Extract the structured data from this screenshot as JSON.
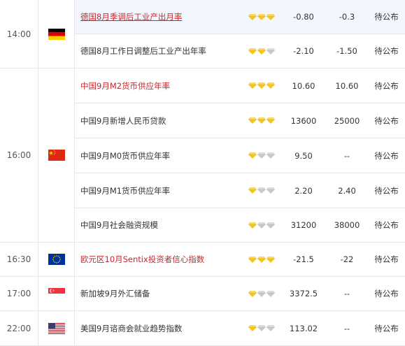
{
  "colors": {
    "gold": "#f5c518",
    "gray": "#c9c9c9",
    "red_text": "#c4292f",
    "highlight_row": "#f3f7fd"
  },
  "star_icon": "gem-icon",
  "groups": [
    {
      "time": "14:00",
      "flag": "germany-flag-icon",
      "rows": [
        {
          "event": "德国8月季调后工业产出月率",
          "importance": 3,
          "previous": "-0.80",
          "forecast": "-0.3",
          "actual": "待公布",
          "red": true,
          "highlight": true
        },
        {
          "event": "德国8月工作日调整后工业产出年率",
          "importance": 2,
          "previous": "-2.10",
          "forecast": "-1.50",
          "actual": "待公布",
          "red": false,
          "highlight": false
        }
      ]
    },
    {
      "time": "16:00",
      "flag": "china-flag-icon",
      "rows": [
        {
          "event": "中国9月M2货币供应年率",
          "importance": 3,
          "previous": "10.60",
          "forecast": "10.60",
          "actual": "待公布",
          "red": true,
          "highlight": false
        },
        {
          "event": "中国9月新增人民币贷款",
          "importance": 3,
          "previous": "13600",
          "forecast": "25000",
          "actual": "待公布",
          "red": false,
          "highlight": false
        },
        {
          "event": "中国9月M0货币供应年率",
          "importance": 1,
          "previous": "9.50",
          "forecast": "--",
          "actual": "待公布",
          "red": false,
          "highlight": false
        },
        {
          "event": "中国9月M1货币供应年率",
          "importance": 1,
          "previous": "2.20",
          "forecast": "2.40",
          "actual": "待公布",
          "red": false,
          "highlight": false
        },
        {
          "event": "中国9月社会融资规模",
          "importance": 1,
          "previous": "31200",
          "forecast": "38000",
          "actual": "待公布",
          "red": false,
          "highlight": false
        }
      ]
    },
    {
      "time": "16:30",
      "flag": "eu-flag-icon",
      "rows": [
        {
          "event": "欧元区10月Sentix投资者信心指数",
          "importance": 3,
          "previous": "-21.5",
          "forecast": "-22",
          "actual": "待公布",
          "red": true,
          "highlight": false
        }
      ]
    },
    {
      "time": "17:00",
      "flag": "singapore-flag-icon",
      "rows": [
        {
          "event": "新加坡9月外汇储备",
          "importance": 1,
          "previous": "3372.5",
          "forecast": "--",
          "actual": "待公布",
          "red": false,
          "highlight": false
        }
      ]
    },
    {
      "time": "22:00",
      "flag": "usa-flag-icon",
      "rows": [
        {
          "event": "美国9月谘商会就业趋势指数",
          "importance": 1,
          "previous": "113.02",
          "forecast": "--",
          "actual": "待公布",
          "red": false,
          "highlight": false
        }
      ]
    }
  ]
}
